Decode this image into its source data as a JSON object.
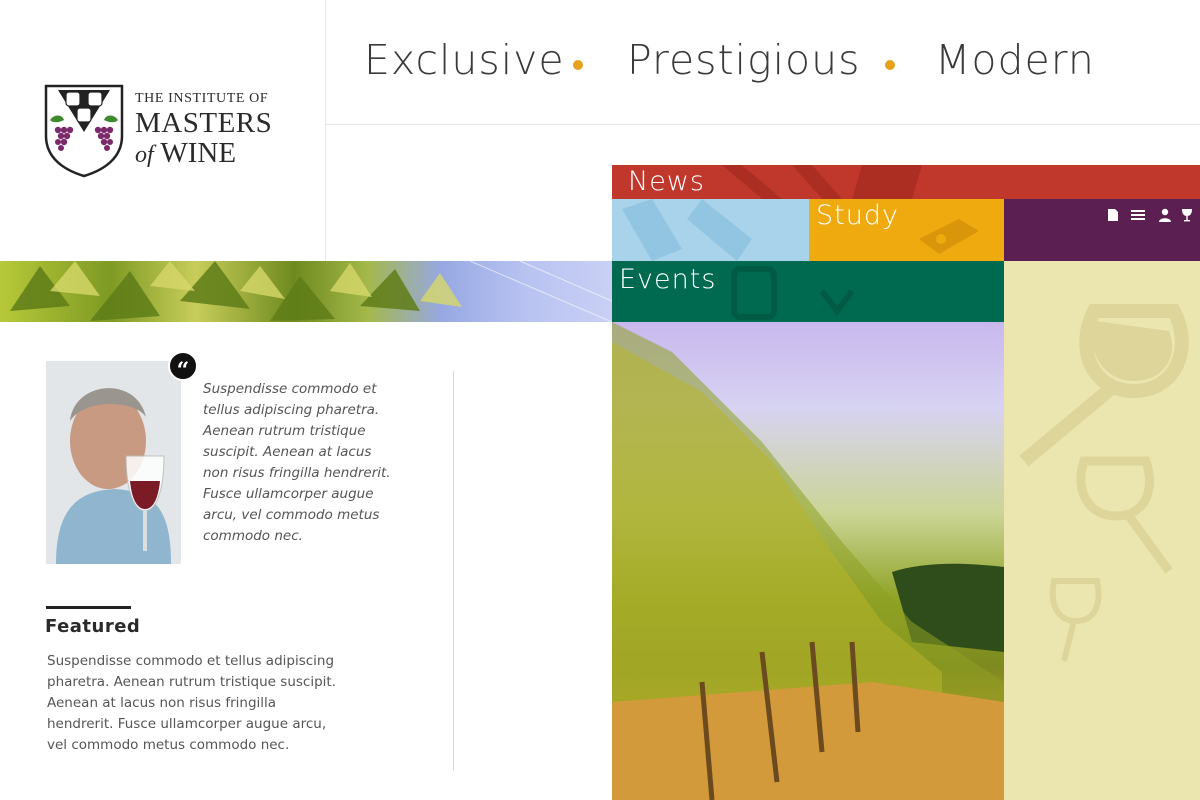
{
  "logo": {
    "line1": "THE INSTITUTE OF",
    "line2": "MASTERS",
    "line3_of": "of",
    "line3_wine": "WINE"
  },
  "tagline": {
    "words": [
      "Exclusive",
      "Prestigious",
      "Modern"
    ],
    "dot_color": "#e7a21c"
  },
  "nav": {
    "news": "News",
    "study": "Study",
    "events": "Events",
    "utility_icons": [
      "document-icon",
      "menu-icon",
      "user-icon",
      "wine-glass-icon"
    ]
  },
  "quote": {
    "mark": "“",
    "text": "Suspendisse commodo et tellus adipiscing pharetra. Aenean rutrum tristique suscipit. Aenean at lacus non risus fringilla hendrerit. Fusce ullamcorper augue arcu, vel commodo metus commodo nec."
  },
  "featured": {
    "title": "Featured",
    "text": "Suspendisse commodo et tellus adipiscing pharetra. Aenean rutrum tristique suscipit. Aenean at lacus non risus fringilla hendrerit. Fusce ullamcorper augue arcu, vel commodo metus commodo nec."
  },
  "colors": {
    "news": "#c0382b",
    "sky": "#a9d3ea",
    "study": "#efaa10",
    "plum": "#5b2051",
    "events": "#006a50",
    "cream": "#ebe6b0"
  }
}
